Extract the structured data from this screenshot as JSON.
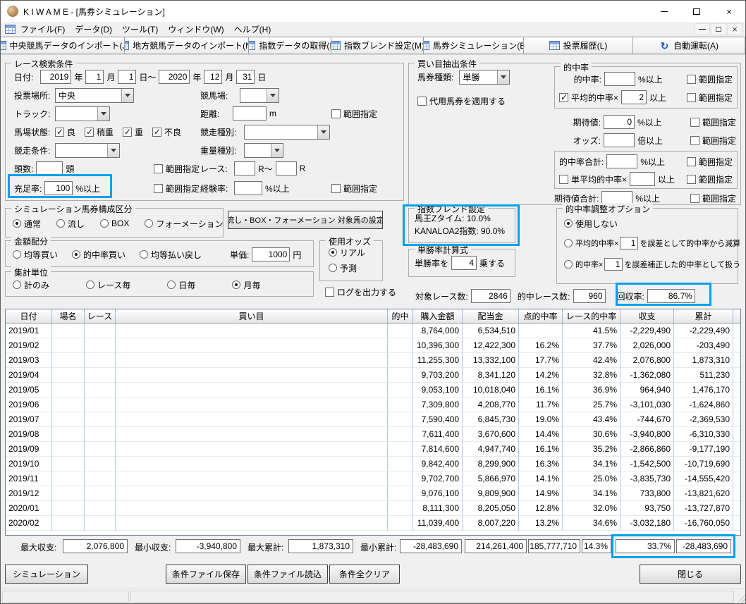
{
  "colors": {
    "highlight": "#00a2e8",
    "grid_icon_blue": "#4f74b3"
  },
  "titlebar": {
    "title": "K I W A M E - [馬券シミュレーション]",
    "close": "×"
  },
  "menubar": {
    "items": [
      {
        "label": "ファイル(F)"
      },
      {
        "label": "データ(D)"
      },
      {
        "label": "ツール(T)"
      },
      {
        "label": "ウィンドウ(W)"
      },
      {
        "label": "ヘルプ(H)"
      }
    ]
  },
  "toolbar": {
    "buttons": [
      {
        "label": "中央競馬データのインポート(J)",
        "icon": "table-icon"
      },
      {
        "label": "地方競馬データのインポート(N)",
        "icon": "table-icon"
      },
      {
        "label": "指数データの取得(I)",
        "icon": "table-icon"
      },
      {
        "label": "指数ブレンド設定(M)",
        "icon": "table-icon"
      },
      {
        "label": "馬券シミュレーション(B)",
        "icon": "table-icon"
      },
      {
        "label": "投票履歴(L)",
        "icon": "table-icon"
      },
      {
        "label": "自動運転(A)",
        "icon": "autorun-icon"
      }
    ]
  },
  "search": {
    "title": "レース検索条件",
    "date_label": "日付:",
    "from_year": "2019",
    "from_month": "1",
    "from_day": "1",
    "to_year": "2020",
    "to_month": "12",
    "to_day": "31",
    "year_unit": "年",
    "month_unit": "月",
    "day_unit": "日",
    "day_range_unit": "日～",
    "place_label": "投票場所:",
    "place_value": "中央",
    "course_label": "競馬場:",
    "course_value": "",
    "track_label": "トラック:",
    "track_value": "",
    "distance_label": "距離:",
    "distance_value": "",
    "distance_unit": "m",
    "range_label": "範囲指定",
    "baba_label": "馬場状態:",
    "baba_options": [
      {
        "label": "良",
        "checked": true
      },
      {
        "label": "稍重",
        "checked": true
      },
      {
        "label": "重",
        "checked": true
      },
      {
        "label": "不良",
        "checked": true
      }
    ],
    "race_type_label": "競走種別:",
    "race_type_value": "",
    "race_cond_label": "競走条件:",
    "race_cond_value": "",
    "weight_label": "重量種別:",
    "weight_value": "",
    "heads_label": "頭数:",
    "heads_value": "",
    "heads_unit": "頭",
    "race_no_label": "レース:",
    "race_from": "",
    "race_tilde": "R～",
    "race_to": "",
    "race_unit": "R",
    "fill_label": "充足率:",
    "fill_value": "100",
    "fill_unit": "%以上",
    "exp_label": "経験率:",
    "exp_value": "",
    "exp_unit": "%以上"
  },
  "extract": {
    "title": "買い目抽出条件",
    "ticket_label": "馬券種類:",
    "ticket_value": "単勝",
    "substitute_label": "代用馬券を適用する",
    "substitute_checked": false,
    "range_label": "範囲指定",
    "hit_group_title": "的中率",
    "hit_label": "的中率:",
    "hit_value": "",
    "hit_unit": "%以上",
    "avg_label": "平均的中率×",
    "avg_value": "2",
    "avg_unit": "以上",
    "avg_checked": true,
    "expect_label": "期待値:",
    "expect_value": "0",
    "expect_unit": "%以上",
    "odds_label": "オッズ:",
    "odds_value": "",
    "odds_unit": "倍以上",
    "hitsum_label": "的中率合計:",
    "hitsum_value": "",
    "hitsum_unit": "%以上",
    "avgsum_label": "単平均的中率×",
    "avgsum_value": "",
    "avgsum_unit": "以上",
    "avgsum_checked": false,
    "expectsum_label": "期待値合計:",
    "expectsum_value": "",
    "expectsum_unit": "%以上"
  },
  "blend": {
    "title": "指数ブレンド設定",
    "line1": "馬王Zタイム: 10.0%",
    "line2": "KANALOA2指数: 90.0%"
  },
  "adjust": {
    "title": "的中率調整オプション",
    "opt1_label": "使用しない",
    "opt1_selected": true,
    "opt2_pre": "平均的中率×",
    "opt2_value": "1",
    "opt2_post": "を誤差として的中率から減算",
    "opt2_selected": false,
    "opt3_pre": "的中率×",
    "opt3_value": "1",
    "opt3_post": "を誤差補正した的中率として扱う",
    "opt3_selected": false
  },
  "winrate": {
    "title": "単勝率計算式",
    "pre": "単勝率を",
    "value": "4",
    "post": "乗する"
  },
  "composition": {
    "title": "シミュレーション馬券構成区分",
    "options": [
      {
        "label": "通常",
        "selected": true
      },
      {
        "label": "流し",
        "selected": false
      },
      {
        "label": "BOX",
        "selected": false
      },
      {
        "label": "フォーメーション",
        "selected": false
      }
    ],
    "setting_button": "流し・BOX・フォーメーション 対象馬の設定"
  },
  "amount": {
    "title": "金額配分",
    "options": [
      {
        "label": "均等買い",
        "selected": false
      },
      {
        "label": "的中率買い",
        "selected": true
      },
      {
        "label": "均等払い戻し",
        "selected": false
      }
    ],
    "unit_label": "単価:",
    "unit_value": "1000",
    "unit_suffix": "円"
  },
  "odds_use": {
    "title": "使用オッズ",
    "options": [
      {
        "label": "リアル",
        "selected": true
      },
      {
        "label": "予測",
        "selected": false
      }
    ]
  },
  "aggregate": {
    "title": "集計単位",
    "options": [
      {
        "label": "計のみ",
        "selected": false
      },
      {
        "label": "レース毎",
        "selected": false
      },
      {
        "label": "日毎",
        "selected": false
      },
      {
        "label": "月毎",
        "selected": true
      }
    ]
  },
  "log_label": "ログを出力する",
  "log_checked": false,
  "stats": {
    "target_label": "対象レース数:",
    "target_value": "2846",
    "hit_label": "的中レース数:",
    "hit_value": "960",
    "recovery_label": "回収率:",
    "recovery_value": "86.7%"
  },
  "table": {
    "columns": [
      "日付",
      "場名",
      "レース",
      "買い目",
      "的中",
      "購入金額",
      "配当金",
      "点的中率",
      "レース的中率",
      "収支",
      "累計"
    ],
    "rows": [
      {
        "date": "2019/01",
        "place": "",
        "race": "",
        "pick": "",
        "hit": "",
        "purchase": "8,764,000",
        "payout": "6,534,510",
        "point_rate": "",
        "race_rate": "41.5%",
        "balance": "-2,229,490",
        "total": "-2,229,490"
      },
      {
        "date": "2019/02",
        "place": "",
        "race": "",
        "pick": "",
        "hit": "",
        "purchase": "10,396,300",
        "payout": "12,422,300",
        "point_rate": "16.2%",
        "race_rate": "37.7%",
        "balance": "2,026,000",
        "total": "-203,490"
      },
      {
        "date": "2019/03",
        "place": "",
        "race": "",
        "pick": "",
        "hit": "",
        "purchase": "11,255,300",
        "payout": "13,332,100",
        "point_rate": "17.7%",
        "race_rate": "42.4%",
        "balance": "2,076,800",
        "total": "1,873,310"
      },
      {
        "date": "2019/04",
        "place": "",
        "race": "",
        "pick": "",
        "hit": "",
        "purchase": "9,703,200",
        "payout": "8,341,120",
        "point_rate": "14.2%",
        "race_rate": "32.8%",
        "balance": "-1,362,080",
        "total": "511,230"
      },
      {
        "date": "2019/05",
        "place": "",
        "race": "",
        "pick": "",
        "hit": "",
        "purchase": "9,053,100",
        "payout": "10,018,040",
        "point_rate": "16.1%",
        "race_rate": "36.9%",
        "balance": "964,940",
        "total": "1,476,170"
      },
      {
        "date": "2019/06",
        "place": "",
        "race": "",
        "pick": "",
        "hit": "",
        "purchase": "7,309,800",
        "payout": "4,208,770",
        "point_rate": "11.7%",
        "race_rate": "25.7%",
        "balance": "-3,101,030",
        "total": "-1,624,860"
      },
      {
        "date": "2019/07",
        "place": "",
        "race": "",
        "pick": "",
        "hit": "",
        "purchase": "7,590,400",
        "payout": "6,845,730",
        "point_rate": "19.0%",
        "race_rate": "43.4%",
        "balance": "-744,670",
        "total": "-2,369,530"
      },
      {
        "date": "2019/08",
        "place": "",
        "race": "",
        "pick": "",
        "hit": "",
        "purchase": "7,611,400",
        "payout": "3,670,600",
        "point_rate": "14.4%",
        "race_rate": "30.6%",
        "balance": "-3,940,800",
        "total": "-6,310,330"
      },
      {
        "date": "2019/09",
        "place": "",
        "race": "",
        "pick": "",
        "hit": "",
        "purchase": "7,814,600",
        "payout": "4,947,740",
        "point_rate": "16.1%",
        "race_rate": "35.2%",
        "balance": "-2,866,860",
        "total": "-9,177,190"
      },
      {
        "date": "2019/10",
        "place": "",
        "race": "",
        "pick": "",
        "hit": "",
        "purchase": "9,842,400",
        "payout": "8,299,900",
        "point_rate": "16.3%",
        "race_rate": "34.1%",
        "balance": "-1,542,500",
        "total": "-10,719,690"
      },
      {
        "date": "2019/11",
        "place": "",
        "race": "",
        "pick": "",
        "hit": "",
        "purchase": "9,702,700",
        "payout": "5,866,970",
        "point_rate": "14.1%",
        "race_rate": "25.0%",
        "balance": "-3,835,730",
        "total": "-14,555,420"
      },
      {
        "date": "2019/12",
        "place": "",
        "race": "",
        "pick": "",
        "hit": "",
        "purchase": "9,076,100",
        "payout": "9,809,900",
        "point_rate": "14.9%",
        "race_rate": "34.1%",
        "balance": "733,800",
        "total": "-13,821,620"
      },
      {
        "date": "2020/01",
        "place": "",
        "race": "",
        "pick": "",
        "hit": "",
        "purchase": "8,111,300",
        "payout": "8,205,050",
        "point_rate": "12.8%",
        "race_rate": "32.0%",
        "balance": "93,750",
        "total": "-13,727,870"
      },
      {
        "date": "2020/02",
        "place": "",
        "race": "",
        "pick": "",
        "hit": "",
        "purchase": "11,039,400",
        "payout": "8,007,220",
        "point_rate": "13.2%",
        "race_rate": "34.6%",
        "balance": "-3,032,180",
        "total": "-16,760,050"
      }
    ]
  },
  "summary": {
    "max_balance_label": "最大収支:",
    "max_balance": "2,076,800",
    "min_balance_label": "最小収支:",
    "min_balance": "-3,940,800",
    "max_total_label": "最大累計:",
    "max_total": "1,873,310",
    "min_total_label": "最小累計:",
    "min_total": "-28,483,690",
    "purchase_total": "214,261,400",
    "payout_total": "185,777,710",
    "point_rate_total": "14.3%",
    "race_rate_total": "33.7%",
    "grand_total": "-28,483,690"
  },
  "footer": {
    "simulate": "シミュレーション",
    "save": "条件ファイル保存",
    "load": "条件ファイル読込",
    "clear": "条件全クリア",
    "close": "閉じる"
  }
}
